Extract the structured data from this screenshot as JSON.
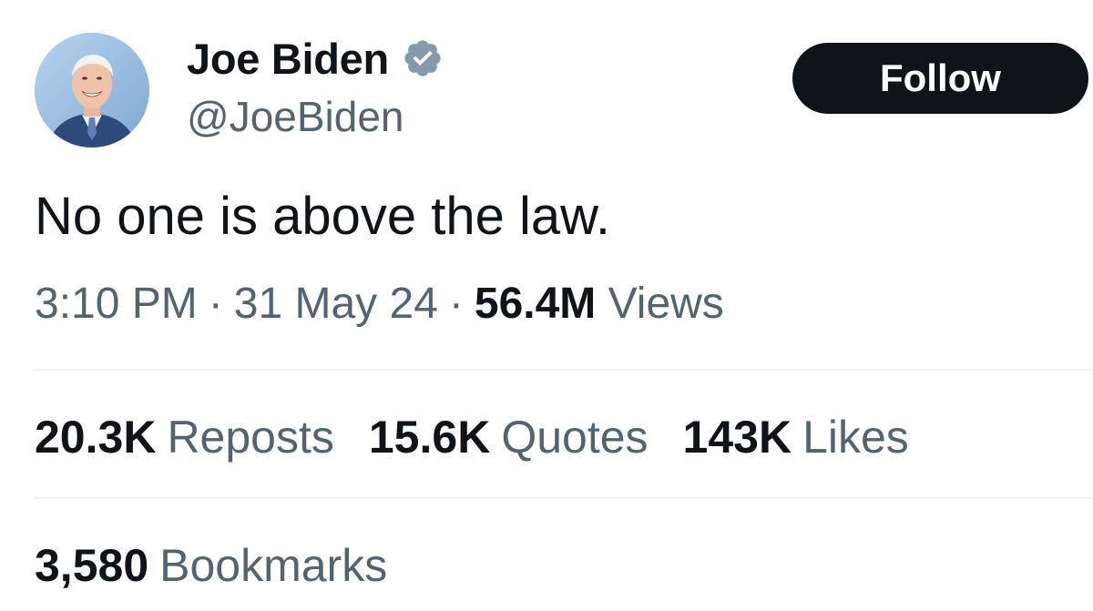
{
  "author": {
    "display_name": "Joe Biden",
    "handle": "@JoeBiden",
    "verified": true,
    "avatar_icon": "profile-photo",
    "verified_icon": "verified-badge-icon"
  },
  "follow_button": {
    "label": "Follow"
  },
  "tweet": {
    "text": "No one is above the law."
  },
  "meta": {
    "time": "3:10 PM",
    "separator": "·",
    "date": "31 May 24",
    "views_count": "56.4M",
    "views_label": "Views"
  },
  "stats": {
    "reposts_count": "20.3K",
    "reposts_label": "Reposts",
    "quotes_count": "15.6K",
    "quotes_label": "Quotes",
    "likes_count": "143K",
    "likes_label": "Likes",
    "bookmarks_count": "3,580",
    "bookmarks_label": "Bookmarks"
  },
  "colors": {
    "text_primary": "#0f1419",
    "text_secondary": "#536471",
    "divider": "#eff3f4",
    "verified_badge": "#829aab",
    "button_bg": "#0f1419",
    "button_text": "#ffffff"
  }
}
